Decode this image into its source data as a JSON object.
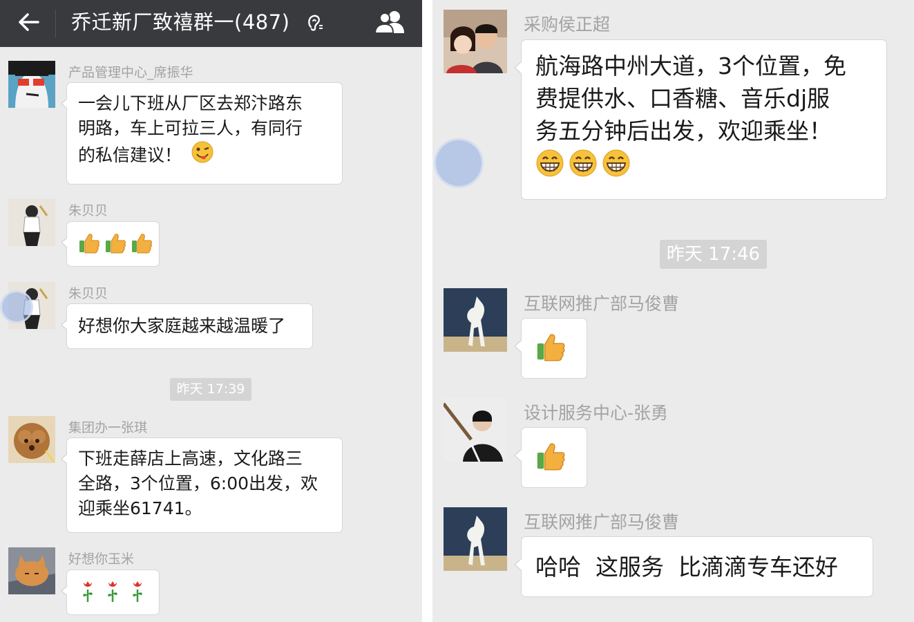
{
  "header": {
    "title": "乔迁新厂致禧群一(487)",
    "back_icon": "back-arrow-icon",
    "mute_icon": "ear-mute-icon",
    "members_icon": "group-members-icon",
    "background": "#393a3e"
  },
  "left_panel": {
    "messages": [
      {
        "sender": "产品管理中心_席振华",
        "text_lines": [
          "一会儿下班从厂区去郑汴路东",
          "明路，车上可拉三人，有同行",
          "的私信建议！"
        ],
        "emoji": [
          "winking-tongue-face-emoji"
        ]
      },
      {
        "sender": "朱贝贝",
        "emoji": [
          "thumbs-up-emoji",
          "thumbs-up-emoji",
          "thumbs-up-emoji"
        ]
      },
      {
        "sender": "朱贝贝",
        "text": "好想你大家庭越来越温暖了"
      },
      {
        "sender": "集团办一张琪",
        "text_lines": [
          "下班走薛店上高速，文化路三",
          "全路，3个位置，6:00出发，欢",
          "迎乘坐61741。"
        ]
      },
      {
        "sender": "好想你玉米",
        "emoji": [
          "rose-emoji",
          "rose-emoji",
          "rose-emoji"
        ]
      }
    ],
    "timestamp": "昨天 17:39"
  },
  "right_panel": {
    "messages": [
      {
        "sender": "采购侯正超",
        "text_lines": [
          "航海路中州大道，3个位置，免",
          "费提供水、口香糖、音乐dj服",
          "务五分钟后出发，欢迎乘坐！"
        ],
        "emoji": [
          "grinning-face-emoji",
          "grinning-face-emoji",
          "grinning-face-emoji"
        ]
      },
      {
        "sender": "互联网推广部马俊曹",
        "emoji": [
          "thumbs-up-emoji"
        ]
      },
      {
        "sender": "设计服务中心-张勇",
        "emoji": [
          "thumbs-up-emoji"
        ]
      },
      {
        "sender": "互联网推广部马俊曹",
        "text": "哈哈  这服务  比滴滴专车还好"
      }
    ],
    "timestamp": "昨天 17:46"
  },
  "colors": {
    "chat_background": "#ebebeb",
    "bubble": "#ffffff",
    "sender_name": "#a3a3a3",
    "timestamp_badge": "#d4d4d4"
  }
}
